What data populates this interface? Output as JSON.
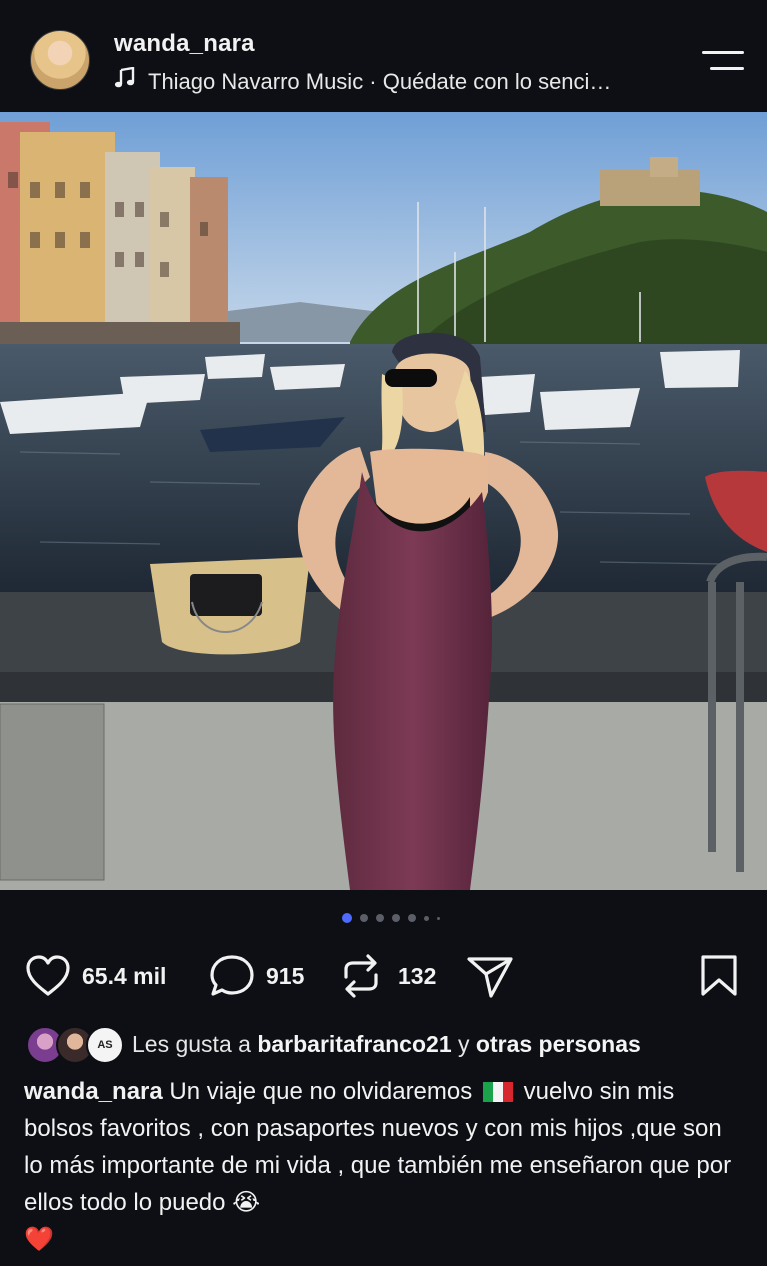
{
  "header": {
    "username": "wanda_nara",
    "music_text": "Thiago Navarro Music · Quédate con lo senci…",
    "icons": {
      "music": "music-note-icon",
      "menu": "menu-icon"
    }
  },
  "carousel": {
    "total": 7,
    "current": 1
  },
  "actions": {
    "likes": "65.4 mil",
    "comments": "915",
    "reposts": "132"
  },
  "liked_by": {
    "prefix": "Les gusta a",
    "user": "barbaritafranco21",
    "middle": "y",
    "others": "otras personas",
    "avatar3_text": "AS"
  },
  "caption": {
    "username": "wanda_nara",
    "line1": "Un viaje que no olvidaremos",
    "line2": "vuelvo sin mis bolsos favoritos , con pasaportes nuevos y con mis hijos ,que son lo más importante de mi vida , que también me enseñaron que por ellos todo lo puedo",
    "emoji_cry": "😭",
    "emoji_heart": "❤️"
  },
  "colors": {
    "background": "#0d0f14",
    "accent_dot": "#4f6bff",
    "text": "#f2f2f2"
  }
}
